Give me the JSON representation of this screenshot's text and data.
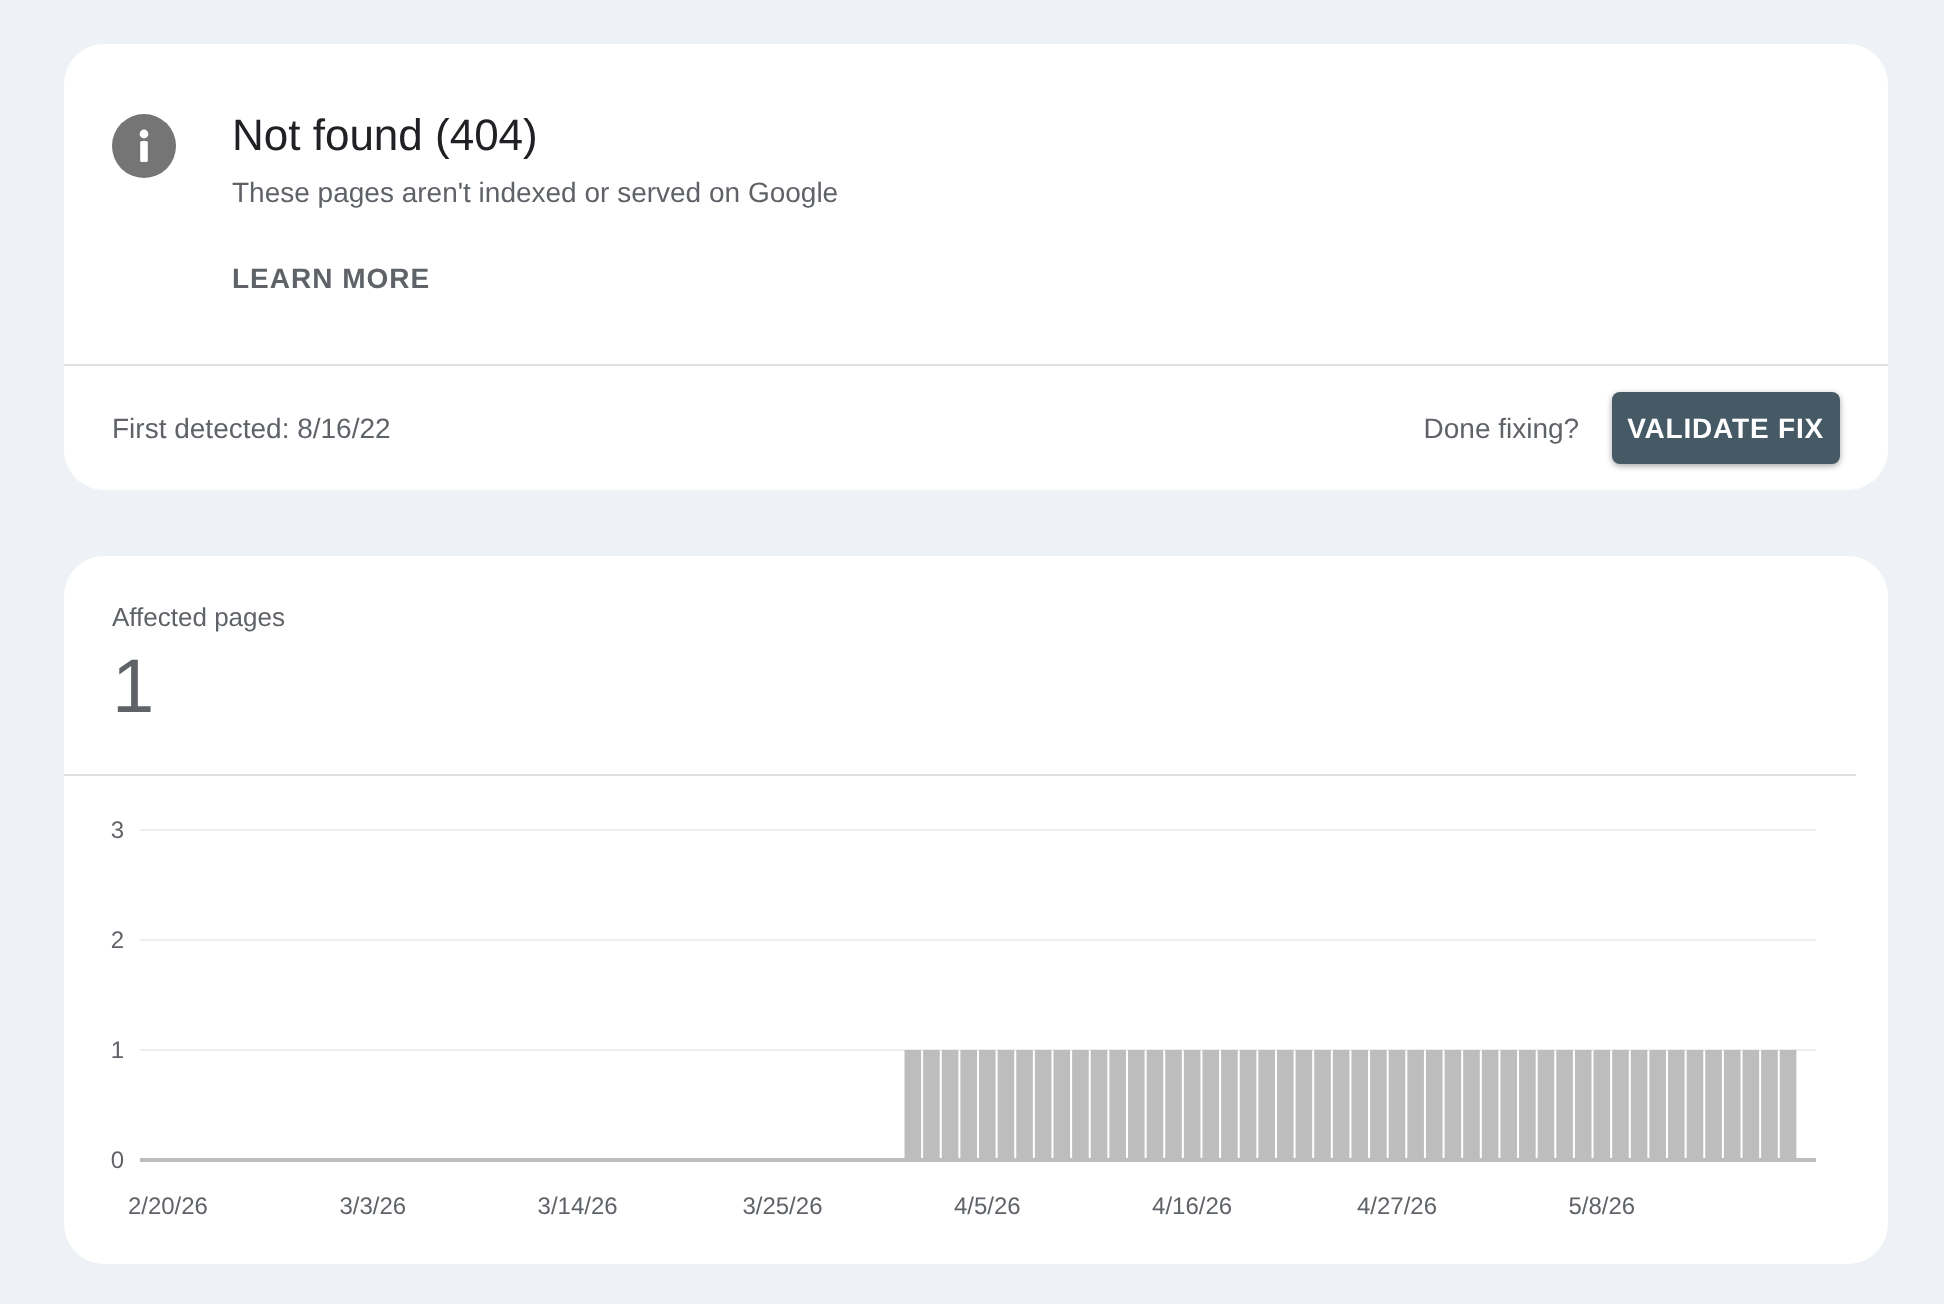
{
  "status_card": {
    "title": "Not found (404)",
    "description": "These pages aren't indexed or served on Google",
    "learn_more": "LEARN MORE",
    "first_detected": "First detected: 8/16/22",
    "done_prompt": "Done fixing?",
    "validate_button": "VALIDATE FIX"
  },
  "affected_card": {
    "label": "Affected pages",
    "count": "1",
    "chart_data": {
      "type": "bar",
      "categories": [
        null,
        "2/20/26",
        null,
        null,
        null,
        null,
        null,
        null,
        null,
        null,
        null,
        null,
        "3/3/26",
        null,
        null,
        null,
        null,
        null,
        null,
        null,
        null,
        null,
        null,
        "3/14/26",
        null,
        null,
        null,
        null,
        null,
        null,
        null,
        null,
        null,
        null,
        "3/25/26",
        null,
        null,
        null,
        null,
        null,
        null,
        null,
        null,
        null,
        null,
        "4/5/26",
        null,
        null,
        null,
        null,
        null,
        null,
        null,
        null,
        null,
        null,
        "4/16/26",
        null,
        null,
        null,
        null,
        null,
        null,
        null,
        null,
        null,
        null,
        "4/27/26",
        null,
        null,
        null,
        null,
        null,
        null,
        null,
        null,
        null,
        null,
        "5/8/26",
        null,
        null,
        null,
        null,
        null,
        null,
        null,
        null,
        null,
        null,
        null
      ],
      "values": [
        0,
        0,
        0,
        0,
        0,
        0,
        0,
        0,
        0,
        0,
        0,
        0,
        0,
        0,
        0,
        0,
        0,
        0,
        0,
        0,
        0,
        0,
        0,
        0,
        0,
        0,
        0,
        0,
        0,
        0,
        0,
        0,
        0,
        0,
        0,
        0,
        0,
        0,
        0,
        0,
        0,
        1,
        1,
        1,
        1,
        1,
        1,
        1,
        1,
        1,
        1,
        1,
        1,
        1,
        1,
        1,
        1,
        1,
        1,
        1,
        1,
        1,
        1,
        1,
        1,
        1,
        1,
        1,
        1,
        1,
        1,
        1,
        1,
        1,
        1,
        1,
        1,
        1,
        1,
        1,
        1,
        1,
        1,
        1,
        1,
        1,
        1,
        1,
        1,
        null
      ],
      "ylim": [
        0,
        3
      ],
      "yticks": [
        0,
        1,
        2,
        3
      ]
    }
  }
}
